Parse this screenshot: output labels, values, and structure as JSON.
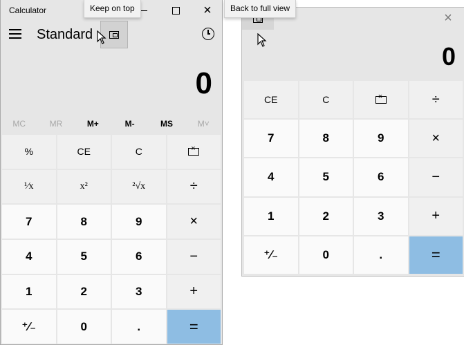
{
  "window_left": {
    "title": "Calculator",
    "tooltip": "Keep on top",
    "mode": "Standard",
    "display": "0",
    "memory": [
      {
        "label": "MC",
        "enabled": false
      },
      {
        "label": "MR",
        "enabled": false
      },
      {
        "label": "M+",
        "enabled": true
      },
      {
        "label": "M-",
        "enabled": true
      },
      {
        "label": "MS",
        "enabled": true
      },
      {
        "label": "M˅",
        "enabled": false
      }
    ],
    "keys": [
      {
        "label": "%",
        "type": "fn"
      },
      {
        "label": "CE",
        "type": "fn"
      },
      {
        "label": "C",
        "type": "fn"
      },
      {
        "label": "⌫",
        "type": "fn",
        "icon": "backspace-icon"
      },
      {
        "label": "¹⁄x",
        "type": "fn"
      },
      {
        "label": "x²",
        "type": "fn"
      },
      {
        "label": "²√x",
        "type": "fn"
      },
      {
        "label": "÷",
        "type": "op"
      },
      {
        "label": "7",
        "type": "num"
      },
      {
        "label": "8",
        "type": "num"
      },
      {
        "label": "9",
        "type": "num"
      },
      {
        "label": "×",
        "type": "op"
      },
      {
        "label": "4",
        "type": "num"
      },
      {
        "label": "5",
        "type": "num"
      },
      {
        "label": "6",
        "type": "num"
      },
      {
        "label": "−",
        "type": "op"
      },
      {
        "label": "1",
        "type": "num"
      },
      {
        "label": "2",
        "type": "num"
      },
      {
        "label": "3",
        "type": "num"
      },
      {
        "label": "+",
        "type": "op"
      },
      {
        "label": "⁺∕₋",
        "type": "num"
      },
      {
        "label": "0",
        "type": "num"
      },
      {
        "label": ".",
        "type": "num"
      },
      {
        "label": "=",
        "type": "eq"
      }
    ]
  },
  "window_right": {
    "tooltip": "Back to full view",
    "display": "0",
    "keys": [
      {
        "label": "CE",
        "type": "fn"
      },
      {
        "label": "C",
        "type": "fn"
      },
      {
        "label": "⌫",
        "type": "fn",
        "icon": "backspace-icon"
      },
      {
        "label": "÷",
        "type": "op"
      },
      {
        "label": "7",
        "type": "num"
      },
      {
        "label": "8",
        "type": "num"
      },
      {
        "label": "9",
        "type": "num"
      },
      {
        "label": "×",
        "type": "op"
      },
      {
        "label": "4",
        "type": "num"
      },
      {
        "label": "5",
        "type": "num"
      },
      {
        "label": "6",
        "type": "num"
      },
      {
        "label": "−",
        "type": "op"
      },
      {
        "label": "1",
        "type": "num"
      },
      {
        "label": "2",
        "type": "num"
      },
      {
        "label": "3",
        "type": "num"
      },
      {
        "label": "+",
        "type": "op"
      },
      {
        "label": "⁺∕₋",
        "type": "num"
      },
      {
        "label": "0",
        "type": "num"
      },
      {
        "label": ".",
        "type": "num"
      },
      {
        "label": "=",
        "type": "eq"
      }
    ]
  },
  "icons": {
    "minimize": "minimize-icon",
    "maximize": "maximize-icon",
    "close": "close-icon",
    "menu": "hamburger-menu-icon",
    "keep_on_top": "keep-on-top-icon",
    "history": "history-icon",
    "back_to_full": "back-to-full-view-icon",
    "cursor": "mouse-pointer-icon"
  },
  "colors": {
    "equals_key": "#8ebde3",
    "window_bg": "#e6e6e6",
    "number_key_bg": "#fafafa",
    "function_key_bg": "#f0f0f0"
  }
}
